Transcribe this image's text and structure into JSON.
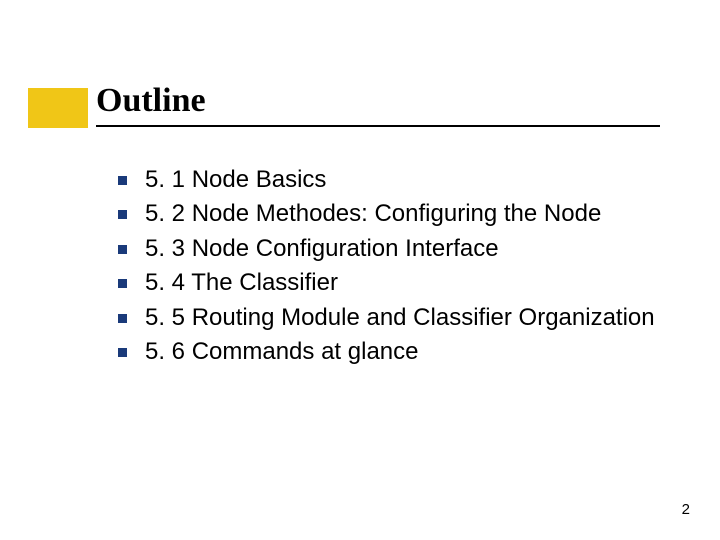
{
  "title": "Outline",
  "items": [
    {
      "text": "5. 1 Node Basics"
    },
    {
      "text": "5. 2 Node Methodes: Configuring the Node"
    },
    {
      "text": "5. 3 Node Configuration Interface"
    },
    {
      "text": "5. 4 The Classifier"
    },
    {
      "text": "5. 5 Routing Module and Classifier Organization"
    },
    {
      "text": "5. 6 Commands at glance"
    }
  ],
  "pageNumber": "2"
}
